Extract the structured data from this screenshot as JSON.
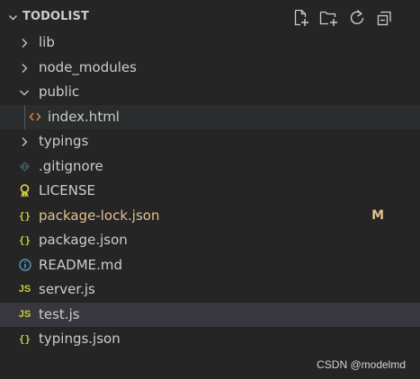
{
  "explorer": {
    "title": "TODOLIST",
    "tools": [
      {
        "icon": "new-file-icon"
      },
      {
        "icon": "new-folder-icon"
      },
      {
        "icon": "refresh-icon"
      },
      {
        "icon": "collapse-all-icon"
      }
    ]
  },
  "tree": {
    "items": [
      {
        "label": "lib",
        "kind": "folder",
        "expanded": false
      },
      {
        "label": "node_modules",
        "kind": "folder",
        "expanded": false
      },
      {
        "label": "public",
        "kind": "folder",
        "expanded": true
      },
      {
        "label": "index.html",
        "kind": "file",
        "icon": "html-icon",
        "icon_glyph": "<>"
      },
      {
        "label": "typings",
        "kind": "folder",
        "expanded": false
      },
      {
        "label": ".gitignore",
        "kind": "file",
        "icon": "git-icon"
      },
      {
        "label": "LICENSE",
        "kind": "file",
        "icon": "license-icon"
      },
      {
        "label": "package-lock.json",
        "kind": "file",
        "icon": "json-icon",
        "icon_glyph": "{}",
        "git_status": "M"
      },
      {
        "label": "package.json",
        "kind": "file",
        "icon": "json-icon",
        "icon_glyph": "{}"
      },
      {
        "label": "README.md",
        "kind": "file",
        "icon": "info-icon"
      },
      {
        "label": "server.js",
        "kind": "file",
        "icon": "js-icon",
        "icon_glyph": "JS"
      },
      {
        "label": "test.js",
        "kind": "file",
        "icon": "js-icon",
        "icon_glyph": "JS",
        "selected": true
      },
      {
        "label": "typings.json",
        "kind": "file",
        "icon": "json-icon",
        "icon_glyph": "{}"
      }
    ]
  },
  "colors": {
    "background": "#252526",
    "text": "#cccccc",
    "modified": "#e2c08d",
    "selected_row": "#37373d",
    "json_js_icon": "#cbcb41",
    "html_icon": "#e37933",
    "info_icon": "#519aba"
  },
  "watermark": "CSDN @modelmd"
}
